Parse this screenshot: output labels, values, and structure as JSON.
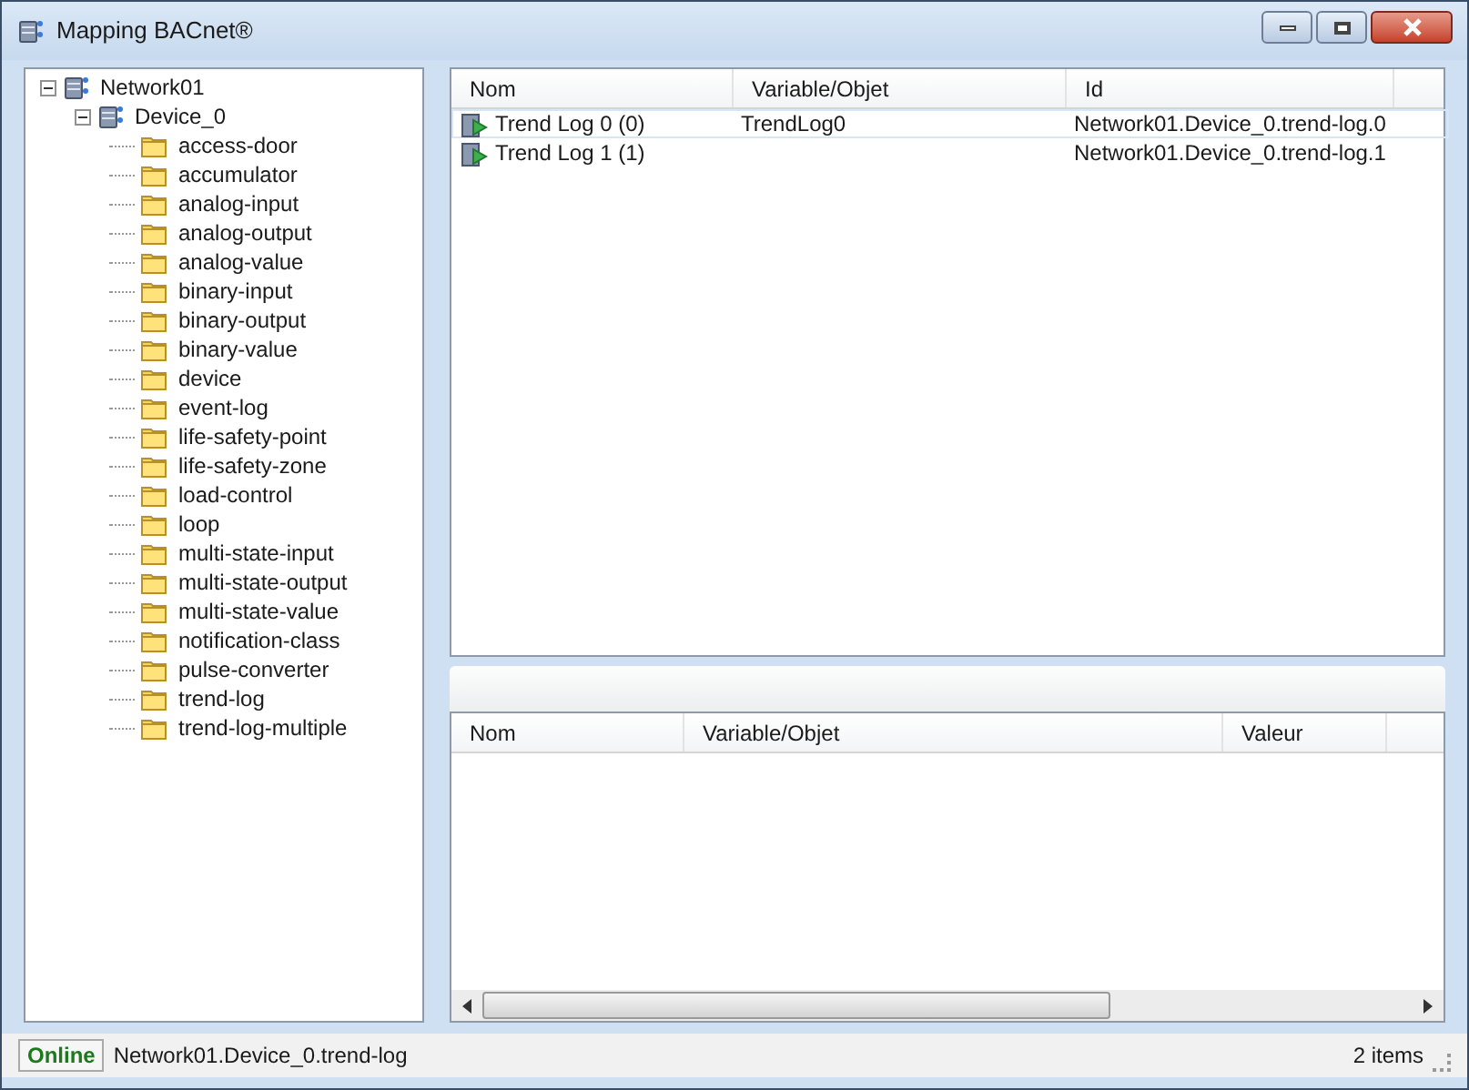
{
  "window": {
    "title": "Mapping BACnet®"
  },
  "tree": [
    {
      "label": "Network01",
      "expanded": true,
      "children": [
        {
          "label": "Device_0",
          "expanded": true,
          "children": [
            {
              "label": "access-door"
            },
            {
              "label": "accumulator"
            },
            {
              "label": "analog-input"
            },
            {
              "label": "analog-output"
            },
            {
              "label": "analog-value"
            },
            {
              "label": "binary-input"
            },
            {
              "label": "binary-output"
            },
            {
              "label": "binary-value"
            },
            {
              "label": "device"
            },
            {
              "label": "event-log"
            },
            {
              "label": "life-safety-point"
            },
            {
              "label": "life-safety-zone"
            },
            {
              "label": "load-control"
            },
            {
              "label": "loop"
            },
            {
              "label": "multi-state-input"
            },
            {
              "label": "multi-state-output"
            },
            {
              "label": "multi-state-value"
            },
            {
              "label": "notification-class"
            },
            {
              "label": "pulse-converter"
            },
            {
              "label": "trend-log"
            },
            {
              "label": "trend-log-multiple"
            }
          ]
        }
      ]
    }
  ],
  "objects_table": {
    "columns": [
      "Nom",
      "Variable/Objet",
      "Id"
    ],
    "rows": [
      {
        "name": "Trend Log 0 (0)",
        "variable": "TrendLog0",
        "id": "Network01.Device_0.trend-log.0",
        "selected": true
      },
      {
        "name": "Trend Log 1 (1)",
        "variable": "",
        "id": "Network01.Device_0.trend-log.1",
        "selected": false
      }
    ]
  },
  "values_table": {
    "columns": [
      "Nom",
      "Variable/Objet",
      "Valeur"
    ]
  },
  "status_bar": {
    "state": "Online",
    "path": "Network01.Device_0.trend-log",
    "count": "2 items"
  }
}
